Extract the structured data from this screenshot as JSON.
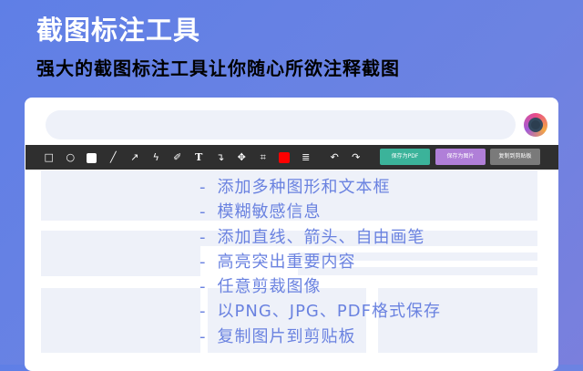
{
  "header": {
    "title": "截图标注工具",
    "subtitle": "强大的截图标注工具让你随心所欲注释截图"
  },
  "toolbar": {
    "tools": [
      "rectangle-icon",
      "circle-icon",
      "fill-icon",
      "line-icon",
      "arrow-icon",
      "pen-icon",
      "marker-icon",
      "text-icon",
      "blur-icon",
      "move-icon",
      "crop-icon",
      "color-icon",
      "stroke-width-icon",
      "undo-icon",
      "redo-icon"
    ],
    "color": "#ff0000",
    "save_pdf": "保存为PDF",
    "save_image": "保存为图片",
    "copy_clipboard": "复制到剪贴板",
    "button_colors": {
      "pdf": "#3bb39a",
      "image": "#b07fd8",
      "copy": "#7a7a7a"
    }
  },
  "features": [
    "添加多种图形和文本框",
    "模糊敏感信息",
    "添加直线、箭头、自由画笔",
    "高亮突出重要内容",
    "任意剪裁图像",
    "以PNG、JPG、PDF格式保存",
    "复制图片到剪贴板"
  ],
  "bullet": "-"
}
